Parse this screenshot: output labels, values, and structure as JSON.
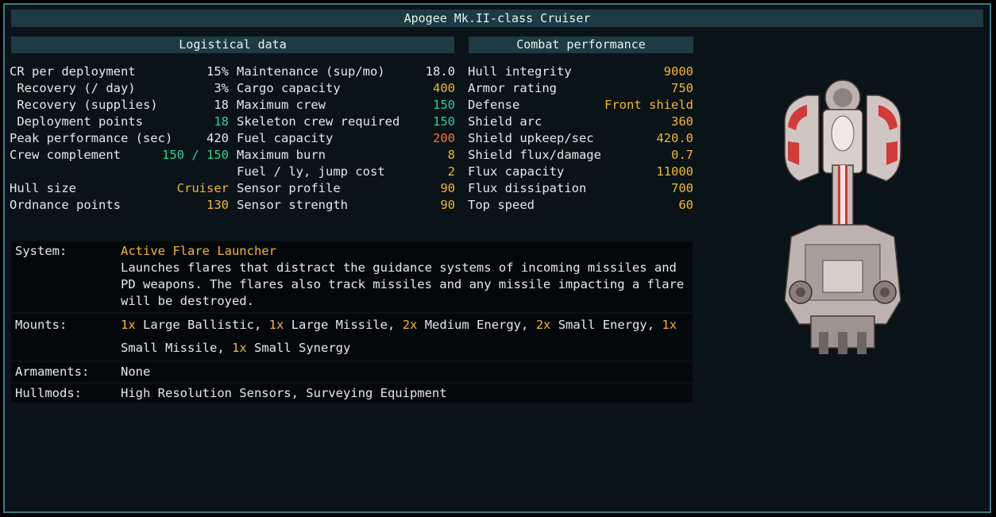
{
  "title": "Apogee Mk.II-class Cruiser",
  "headers": {
    "logistics": "Logistical data",
    "combat": "Combat performance"
  },
  "col1": [
    {
      "label": "CR per deployment",
      "value": "15%",
      "color": "white"
    },
    {
      "label": " Recovery (/ day)",
      "value": "3%",
      "color": "white"
    },
    {
      "label": " Recovery (supplies)",
      "value": "18",
      "color": "white"
    },
    {
      "label": " Deployment points",
      "value": "18",
      "color": "green"
    },
    {
      "label": "Peak performance (sec)",
      "value": "420",
      "color": "white"
    },
    {
      "label": "Crew complement",
      "value": "150 / 150",
      "color": "green"
    },
    {
      "label": "",
      "value": "",
      "color": "white"
    },
    {
      "label": "Hull size",
      "value": "Cruiser",
      "color": "gold"
    },
    {
      "label": "Ordnance points",
      "value": "130",
      "color": "gold"
    }
  ],
  "col2": [
    {
      "label": "Maintenance (sup/mo)",
      "value": "18.0",
      "color": "white"
    },
    {
      "label": "Cargo capacity",
      "value": "400",
      "color": "gold"
    },
    {
      "label": "Maximum crew",
      "value": "150",
      "color": "green"
    },
    {
      "label": "Skeleton crew required",
      "value": "150",
      "color": "green"
    },
    {
      "label": "Fuel capacity",
      "value": "200",
      "color": "orange"
    },
    {
      "label": "Maximum burn",
      "value": "8",
      "color": "gold"
    },
    {
      "label": "Fuel / ly, jump cost",
      "value": "2",
      "color": "gold"
    },
    {
      "label": "Sensor profile",
      "value": "90",
      "color": "gold"
    },
    {
      "label": "Sensor strength",
      "value": "90",
      "color": "gold"
    }
  ],
  "col3": [
    {
      "label": "Hull integrity",
      "value": "9000",
      "color": "gold"
    },
    {
      "label": "Armor rating",
      "value": "750",
      "color": "gold"
    },
    {
      "label": "Defense",
      "value": "Front shield",
      "color": "gold"
    },
    {
      "label": "Shield arc",
      "value": "360",
      "color": "gold"
    },
    {
      "label": "Shield upkeep/sec",
      "value": "420.0",
      "color": "gold"
    },
    {
      "label": "Shield flux/damage",
      "value": "0.7",
      "color": "gold"
    },
    {
      "label": "Flux capacity",
      "value": "11000",
      "color": "gold"
    },
    {
      "label": "Flux dissipation",
      "value": "700",
      "color": "gold"
    },
    {
      "label": "Top speed",
      "value": "60",
      "color": "gold"
    }
  ],
  "system": {
    "label": "System:",
    "name": "Active Flare Launcher",
    "description": "Launches flares that distract the guidance systems of incoming missiles and PD weapons. The flares also track missiles and any missile impacting a flare will be destroyed."
  },
  "mounts": {
    "label": "Mounts:",
    "items": [
      {
        "count": "1x",
        "name": "Large Ballistic"
      },
      {
        "count": "1x",
        "name": "Large Missile"
      },
      {
        "count": "2x",
        "name": "Medium Energy"
      },
      {
        "count": "2x",
        "name": "Small Energy"
      },
      {
        "count": "1x",
        "name": "Small Missile"
      },
      {
        "count": "1x",
        "name": "Small Synergy"
      }
    ]
  },
  "armaments": {
    "label": "Armaments:",
    "value": "None"
  },
  "hullmods": {
    "label": "Hullmods:",
    "value": "High Resolution Sensors, Surveying Equipment"
  },
  "ship_icon": "ship-sprite-icon"
}
